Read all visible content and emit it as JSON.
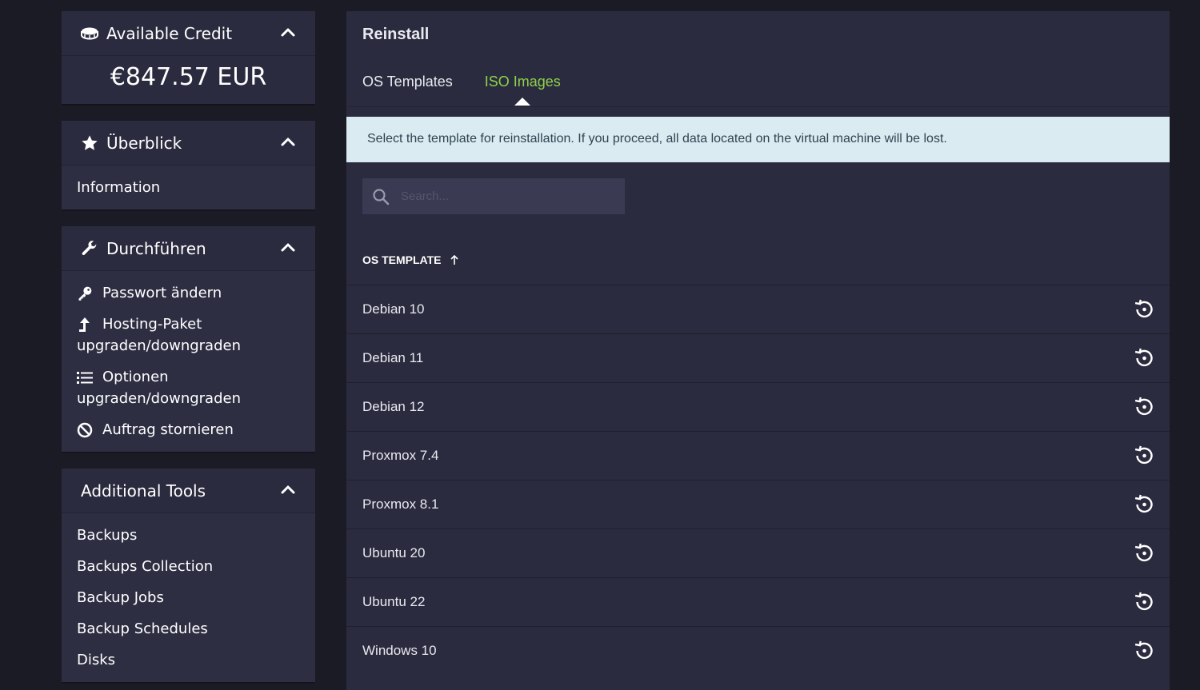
{
  "sidebar": {
    "credit": {
      "title": "Available Credit",
      "amount": "€847.57 EUR"
    },
    "overview": {
      "title": "Überblick",
      "items": [
        {
          "label": "Information"
        }
      ]
    },
    "actions": {
      "title": "Durchführen",
      "items": [
        {
          "label": "Passwort ändern",
          "icon": "key-icon"
        },
        {
          "label": "Hosting-Paket upgraden/downgraden",
          "icon": "arrow-up-icon"
        },
        {
          "label": "Optionen upgraden/downgraden",
          "icon": "list-icon"
        },
        {
          "label": "Auftrag stornieren",
          "icon": "ban-icon"
        }
      ]
    },
    "tools": {
      "title": "Additional Tools",
      "items": [
        {
          "label": "Backups"
        },
        {
          "label": "Backups Collection"
        },
        {
          "label": "Backup Jobs"
        },
        {
          "label": "Backup Schedules"
        },
        {
          "label": "Disks"
        }
      ]
    }
  },
  "main": {
    "title": "Reinstall",
    "tabs": [
      {
        "label": "OS Templates",
        "active": false
      },
      {
        "label": "ISO Images",
        "active": true
      }
    ],
    "alert": "Select the template for reinstallation. If you proceed, all data located on the virtual machine will be lost.",
    "search": {
      "placeholder": "Search...",
      "value": ""
    },
    "column_header": "OS TEMPLATE",
    "templates": [
      {
        "name": "Debian 10"
      },
      {
        "name": "Debian 11"
      },
      {
        "name": "Debian 12"
      },
      {
        "name": "Proxmox 7.4"
      },
      {
        "name": "Proxmox 8.1"
      },
      {
        "name": "Ubuntu 20"
      },
      {
        "name": "Ubuntu 22"
      },
      {
        "name": "Windows 10"
      }
    ]
  },
  "colors": {
    "background": "#1b1b26",
    "panel": "#2b2b3f",
    "accent_tab": "#8ed24a",
    "alert_bg": "#daebf2",
    "alert_text": "#2f4450"
  }
}
